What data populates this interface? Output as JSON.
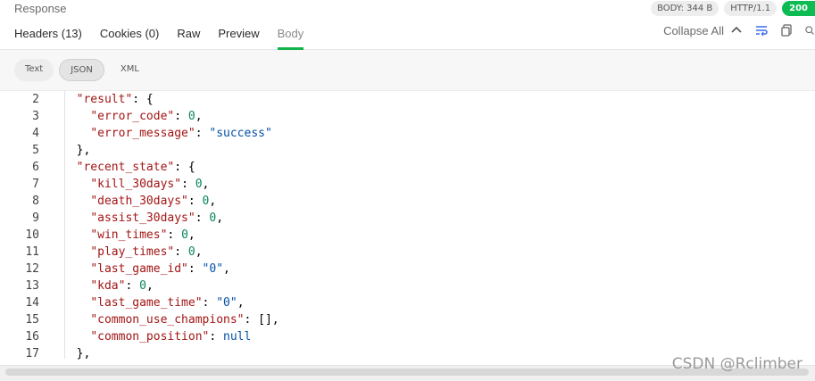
{
  "panel": {
    "title": "Response"
  },
  "badges": {
    "body": "BODY: 344 B",
    "http": "HTTP/1.1",
    "status": "200"
  },
  "tabs": [
    {
      "label": "Headers (13)"
    },
    {
      "label": "Cookies (0)"
    },
    {
      "label": "Raw"
    },
    {
      "label": "Preview"
    },
    {
      "label": "Body"
    }
  ],
  "tools": {
    "collapse_label": "Collapse All"
  },
  "modes": [
    {
      "label": "Text"
    },
    {
      "label": "JSON"
    },
    {
      "label": "XML"
    }
  ],
  "code": {
    "line_numbers": [
      "2",
      "3",
      "4",
      "5",
      "6",
      "7",
      "8",
      "9",
      "10",
      "11",
      "12",
      "13",
      "14",
      "15",
      "16",
      "17"
    ],
    "lines": [
      {
        "indent": "  ",
        "key": "\"result\"",
        "rest": ": {"
      },
      {
        "indent": "    ",
        "key": "\"error_code\"",
        "sep": ": ",
        "num": "0",
        "tail": ","
      },
      {
        "indent": "    ",
        "key": "\"error_message\"",
        "sep": ": ",
        "str": "\"success\""
      },
      {
        "indent": "  ",
        "plain": "},"
      },
      {
        "indent": "  ",
        "key": "\"recent_state\"",
        "rest": ": {"
      },
      {
        "indent": "    ",
        "key": "\"kill_30days\"",
        "sep": ": ",
        "num": "0",
        "tail": ","
      },
      {
        "indent": "    ",
        "key": "\"death_30days\"",
        "sep": ": ",
        "num": "0",
        "tail": ","
      },
      {
        "indent": "    ",
        "key": "\"assist_30days\"",
        "sep": ": ",
        "num": "0",
        "tail": ","
      },
      {
        "indent": "    ",
        "key": "\"win_times\"",
        "sep": ": ",
        "num": "0",
        "tail": ","
      },
      {
        "indent": "    ",
        "key": "\"play_times\"",
        "sep": ": ",
        "num": "0",
        "tail": ","
      },
      {
        "indent": "    ",
        "key": "\"last_game_id\"",
        "sep": ": ",
        "str": "\"0\"",
        "tail": ","
      },
      {
        "indent": "    ",
        "key": "\"kda\"",
        "sep": ": ",
        "num": "0",
        "tail": ","
      },
      {
        "indent": "    ",
        "key": "\"last_game_time\"",
        "sep": ": ",
        "str": "\"0\"",
        "tail": ","
      },
      {
        "indent": "    ",
        "key": "\"common_use_champions\"",
        "rest": ": [],"
      },
      {
        "indent": "    ",
        "key": "\"common_position\"",
        "sep": ": ",
        "lit": "null"
      },
      {
        "indent": "  ",
        "plain": "},"
      }
    ]
  },
  "watermark": "CSDN @Rclimber"
}
